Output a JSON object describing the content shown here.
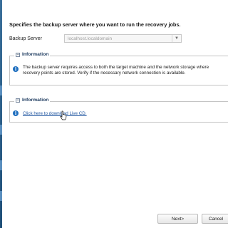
{
  "heading": "Specifies the backup server where you want to run the recovery jobs.",
  "backup_server": {
    "label": "Backup Server",
    "value": "localhost.localdomain"
  },
  "panel1": {
    "toggle": "−",
    "title": "Information",
    "icon": "info-icon",
    "text_line1": "The backup server requires access to both the target machine and the network storage where",
    "text_line2": "recovery points are stored. Verify if the necessary network connection is available."
  },
  "panel2": {
    "toggle": "−",
    "title": "Information",
    "icon": "info-icon",
    "link": "Click here to download Live CD."
  },
  "buttons": {
    "next": "Next>",
    "cancel": "Cancel"
  },
  "colors": {
    "accent": "#1f6fbf",
    "link": "#1f55a0",
    "desktop": "#2b5f8c"
  }
}
